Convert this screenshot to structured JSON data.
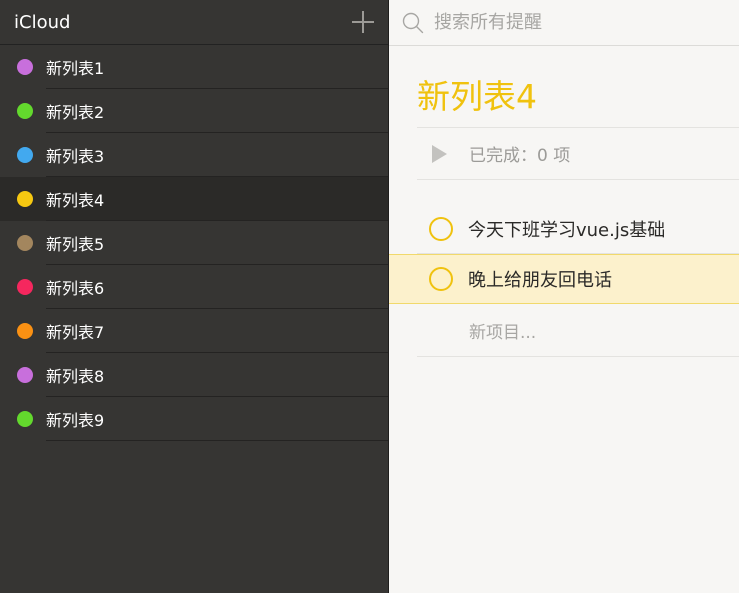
{
  "sidebar": {
    "account_title": "iCloud",
    "add_icon": "plus-icon",
    "selected_index": 3,
    "items": [
      {
        "label": "新列表1",
        "color": "#c86fdc"
      },
      {
        "label": "新列表2",
        "color": "#63d92d"
      },
      {
        "label": "新列表3",
        "color": "#42a9ef"
      },
      {
        "label": "新列表4",
        "color": "#f6c811"
      },
      {
        "label": "新列表5",
        "color": "#a3865e"
      },
      {
        "label": "新列表6",
        "color": "#f5275e"
      },
      {
        "label": "新列表7",
        "color": "#fb9113"
      },
      {
        "label": "新列表8",
        "color": "#c86fdc"
      },
      {
        "label": "新列表9",
        "color": "#63d92d"
      }
    ]
  },
  "search": {
    "icon": "search-icon",
    "placeholder": "搜索所有提醒",
    "value": ""
  },
  "main": {
    "title": "新列表4",
    "accent_color": "#f0c20e",
    "completed_label": "已完成：0 项",
    "tasks": [
      {
        "text": "今天下班学习vue.js基础",
        "completed": false,
        "highlighted": false
      },
      {
        "text": "晚上给朋友回电话",
        "completed": false,
        "highlighted": true
      }
    ],
    "new_item_placeholder": "新项目..."
  }
}
